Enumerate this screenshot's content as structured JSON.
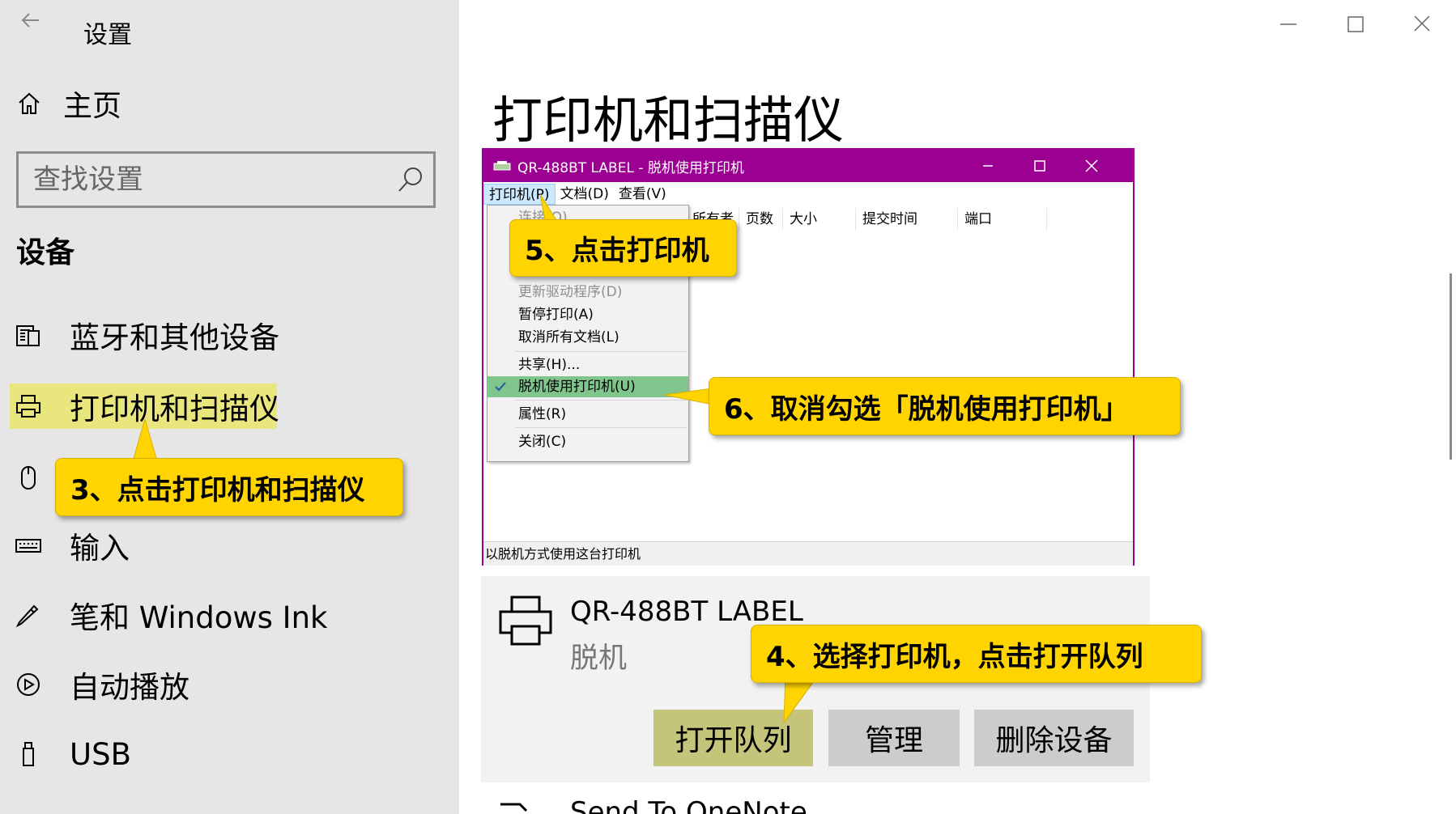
{
  "sidebar": {
    "title": "设置",
    "home": "主页",
    "search_placeholder": "查找设置",
    "section": "设备",
    "items": [
      {
        "label": "蓝牙和其他设备",
        "icon": "bluetooth-devices-icon"
      },
      {
        "label": "打印机和扫描仪",
        "icon": "printer-icon"
      },
      {
        "label": "",
        "icon": "mouse-icon"
      },
      {
        "label": "输入",
        "icon": "keyboard-icon"
      },
      {
        "label": "笔和 Windows Ink",
        "icon": "pen-icon"
      },
      {
        "label": "自动播放",
        "icon": "autoplay-icon"
      },
      {
        "label": "USB",
        "icon": "usb-icon"
      }
    ]
  },
  "main": {
    "title": "打印机和扫描仪",
    "printer": {
      "name": "QR-488BT LABEL",
      "status": "脱机",
      "buttons": [
        "打开队列",
        "管理",
        "删除设备"
      ]
    },
    "next_printer": "Send To OneNote"
  },
  "queue_window": {
    "title": "QR-488BT LABEL  - 脱机使用打印机",
    "menu": [
      "打印机(P)",
      "文档(D)",
      "查看(V)"
    ],
    "columns": [
      "所有者",
      "页数",
      "大小",
      "提交时间",
      "端口"
    ],
    "dropdown": [
      {
        "label": "连接(O)",
        "disabled": true
      },
      {
        "label": "更新驱动程序(D)",
        "disabled": true
      },
      {
        "label": "暂停打印(A)"
      },
      {
        "label": "取消所有文档(L)"
      },
      {
        "label": "共享(H)..."
      },
      {
        "label": "脱机使用打印机(U)",
        "checked": true
      },
      {
        "label": "属性(R)"
      },
      {
        "label": "关闭(C)"
      }
    ],
    "status_bar": "以脱机方式使用这台打印机"
  },
  "callouts": {
    "step3": "3、点击打印机和扫描仪",
    "step4": "4、选择打印机，点击打开队列",
    "step5": "5、点击打印机",
    "step6": "6、取消勾选「脱机使用打印机」"
  },
  "colors": {
    "callout": "#ffd400",
    "selected_nav": "#e9e67e",
    "queue_titlebar": "#9b0093",
    "checked_item": "#80c58c"
  }
}
